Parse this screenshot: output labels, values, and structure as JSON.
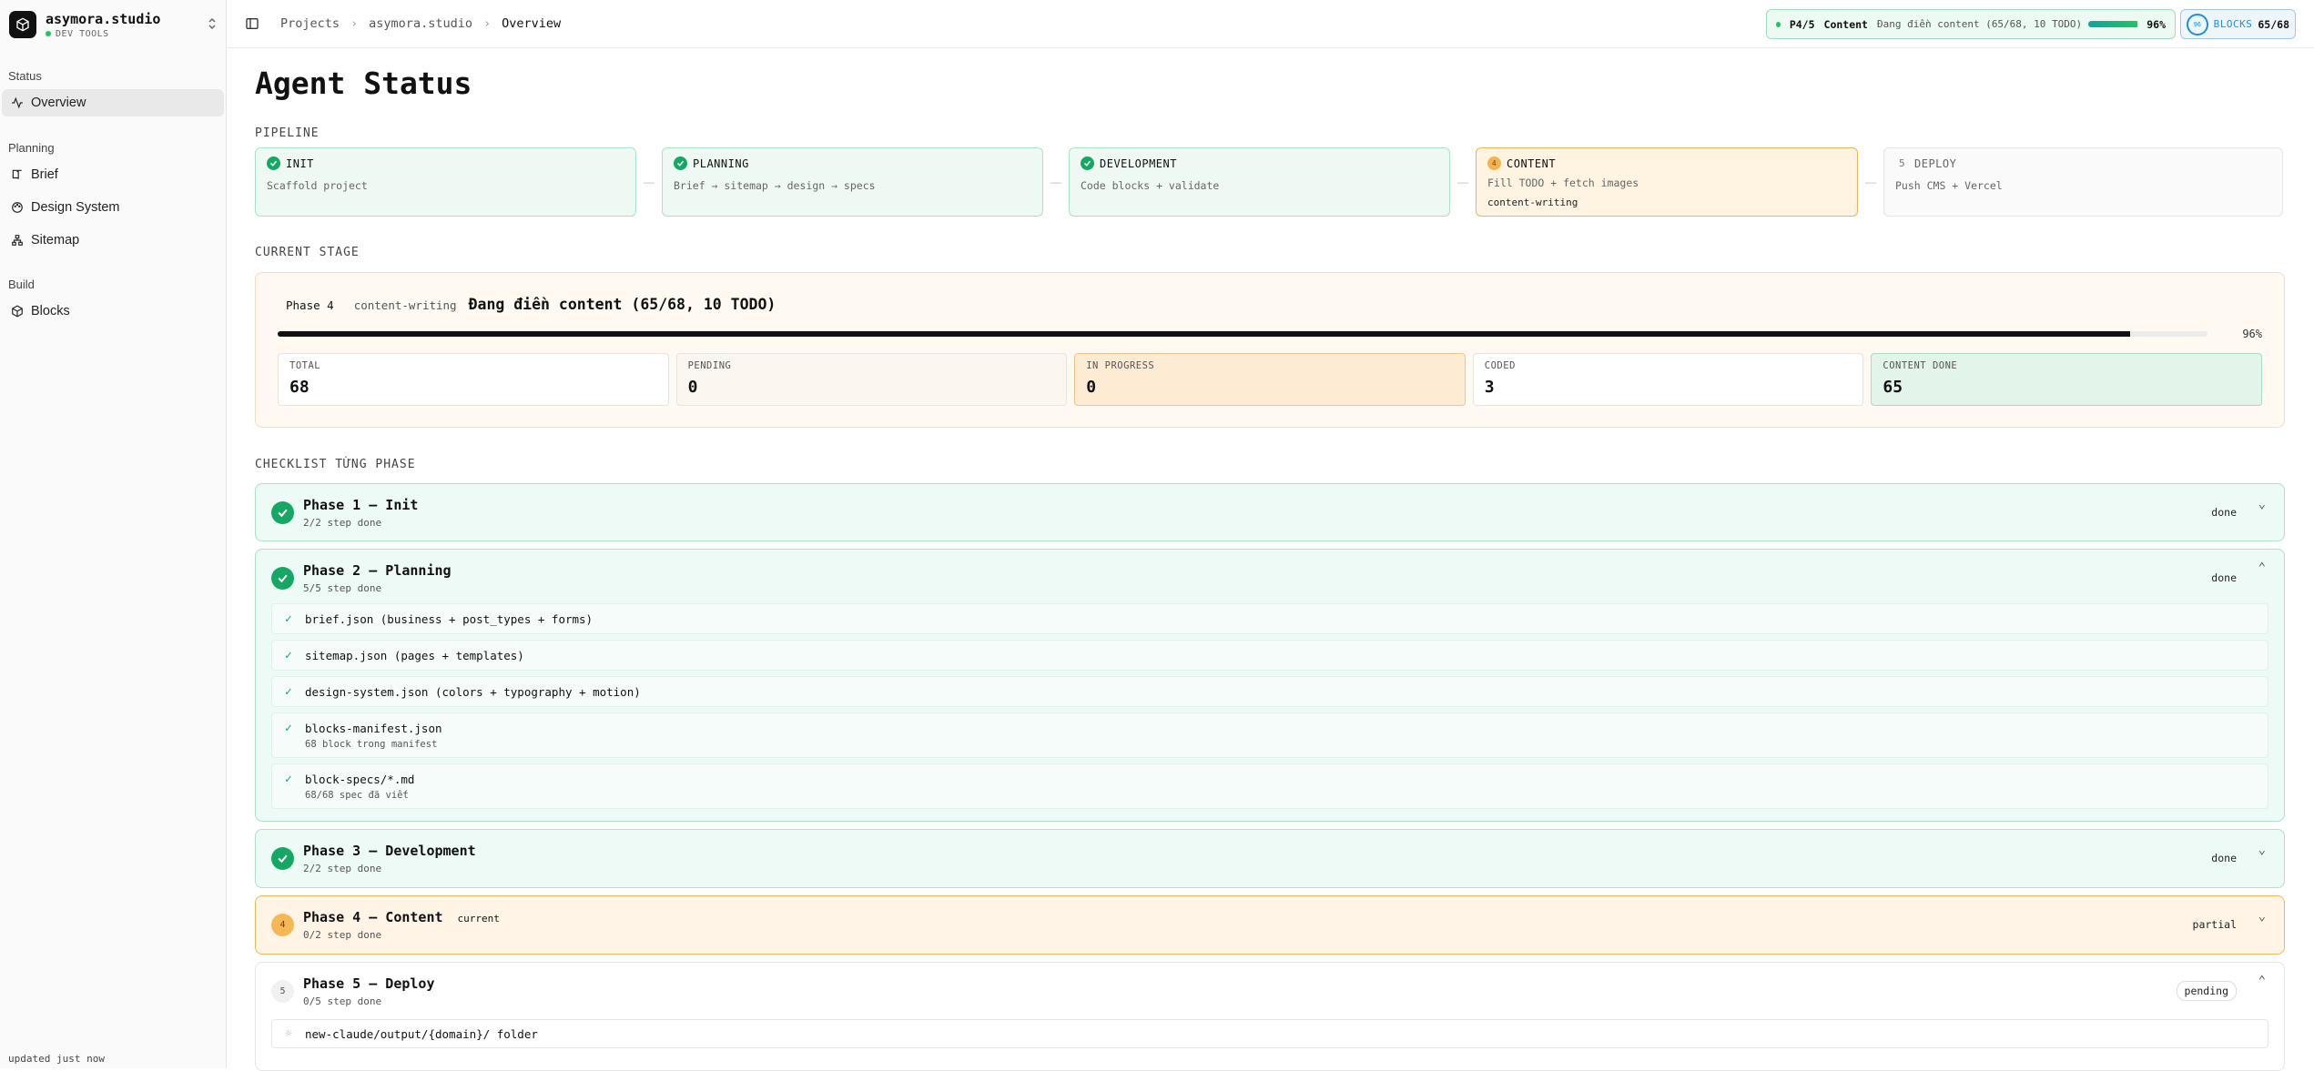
{
  "brand": {
    "name": "asymora.studio",
    "sub": "DEV TOOLS"
  },
  "sidebar": {
    "sections": [
      {
        "label": "Status",
        "items": [
          {
            "label": "Overview",
            "icon": "activity-icon",
            "active": true
          }
        ]
      },
      {
        "label": "Planning",
        "items": [
          {
            "label": "Brief",
            "icon": "book-icon"
          },
          {
            "label": "Design System",
            "icon": "palette-icon"
          },
          {
            "label": "Sitemap",
            "icon": "sitemap-icon"
          }
        ]
      },
      {
        "label": "Build",
        "items": [
          {
            "label": "Blocks",
            "icon": "blocks-icon"
          }
        ]
      }
    ],
    "updated": "updated just now"
  },
  "breadcrumbs": [
    "Projects",
    "asymora.studio",
    "Overview"
  ],
  "status_pill": {
    "phase": "P4/5",
    "label": "Content",
    "desc": "Đang điền content (65/68, 10 TODO)",
    "progress": 0.96,
    "pct": "96%"
  },
  "blocks_pill": {
    "ring": "96",
    "label": "BLOCKS",
    "value": "65/68"
  },
  "page_title": "Agent Status",
  "pipeline": {
    "label": "PIPELINE",
    "stages": [
      {
        "name": "INIT",
        "desc": "Scaffold project",
        "state": "done"
      },
      {
        "name": "PLANNING",
        "desc": "Brief → sitemap → design → specs",
        "state": "done"
      },
      {
        "name": "DEVELOPMENT",
        "desc": "Code blocks + validate",
        "state": "done"
      },
      {
        "name": "CONTENT",
        "desc": "Fill TODO + fetch images",
        "state": "current",
        "num": "4",
        "tag": "content-writing"
      },
      {
        "name": "DEPLOY",
        "desc": "Push CMS + Vercel",
        "state": "pending",
        "num": "5"
      }
    ]
  },
  "current_stage": {
    "label": "CURRENT STAGE",
    "phase": "Phase 4",
    "agent": "content-writing",
    "title": "Đang điền content (65/68, 10 TODO)",
    "progress": 0.96,
    "pct": "96%",
    "stats": [
      {
        "key": "TOTAL",
        "value": "68"
      },
      {
        "key": "PENDING",
        "value": "0"
      },
      {
        "key": "IN PROGRESS",
        "value": "0"
      },
      {
        "key": "CODED",
        "value": "3"
      },
      {
        "key": "CONTENT DONE",
        "value": "65"
      }
    ]
  },
  "checklist": {
    "label": "CHECKLIST TỪNG PHASE",
    "phases": [
      {
        "title": "Phase 1 — Init",
        "sub": "2/2 step done",
        "status": "done"
      },
      {
        "title": "Phase 2 — Planning",
        "sub": "5/5 step done",
        "status": "done",
        "items": [
          {
            "text": "brief.json (business + post_types + forms)"
          },
          {
            "text": "sitemap.json (pages + templates)"
          },
          {
            "text": "design-system.json (colors + typography + motion)"
          },
          {
            "text": "blocks-manifest.json",
            "detail": "68 block trong manifest"
          },
          {
            "text": "block-specs/*.md",
            "detail": "68/68 spec đã viết"
          }
        ]
      },
      {
        "title": "Phase 3 — Development",
        "sub": "2/2 step done",
        "status": "done"
      },
      {
        "title": "Phase 4 — Content",
        "badge": "current",
        "num": "4",
        "sub": "0/2 step done",
        "status": "partial"
      },
      {
        "title": "Phase 5 — Deploy",
        "num": "5",
        "sub": "0/5 step done",
        "status": "pending",
        "items": [
          {
            "text": "new-claude/output/{domain}/ folder"
          }
        ]
      }
    ]
  }
}
